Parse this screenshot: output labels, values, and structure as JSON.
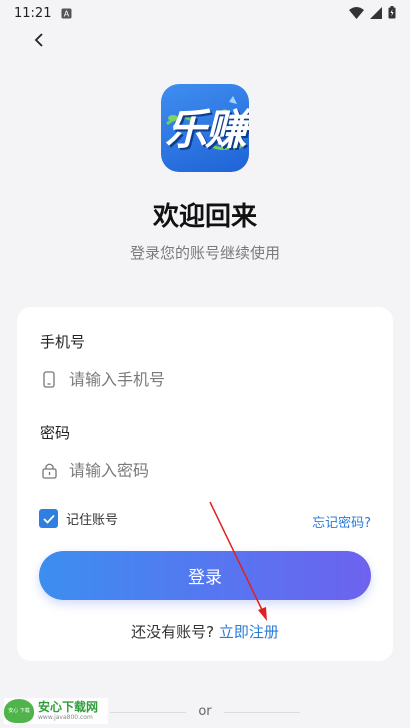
{
  "status_bar": {
    "time": "11:21"
  },
  "logo": {
    "text": "乐赚"
  },
  "header": {
    "title": "欢迎回来",
    "subtitle": "登录您的账号继续使用"
  },
  "form": {
    "phone_label": "手机号",
    "phone_placeholder": "请输入手机号",
    "password_label": "密码",
    "password_placeholder": "请输入密码",
    "remember_label": "记住账号",
    "remember_checked": true,
    "forgot_link": "忘记密码?",
    "login_button": "登录",
    "register_prompt": "还没有账号?",
    "register_link": "立即注册"
  },
  "divider": {
    "text": "or"
  },
  "watermark": {
    "badge_text": "安心 下载",
    "title": "安心下载网",
    "url": "www.java800.com"
  },
  "colors": {
    "accent": "#2f7fe1",
    "button_start": "#3c8ef0",
    "button_end": "#6d62ef",
    "arrow": "#e02020"
  }
}
